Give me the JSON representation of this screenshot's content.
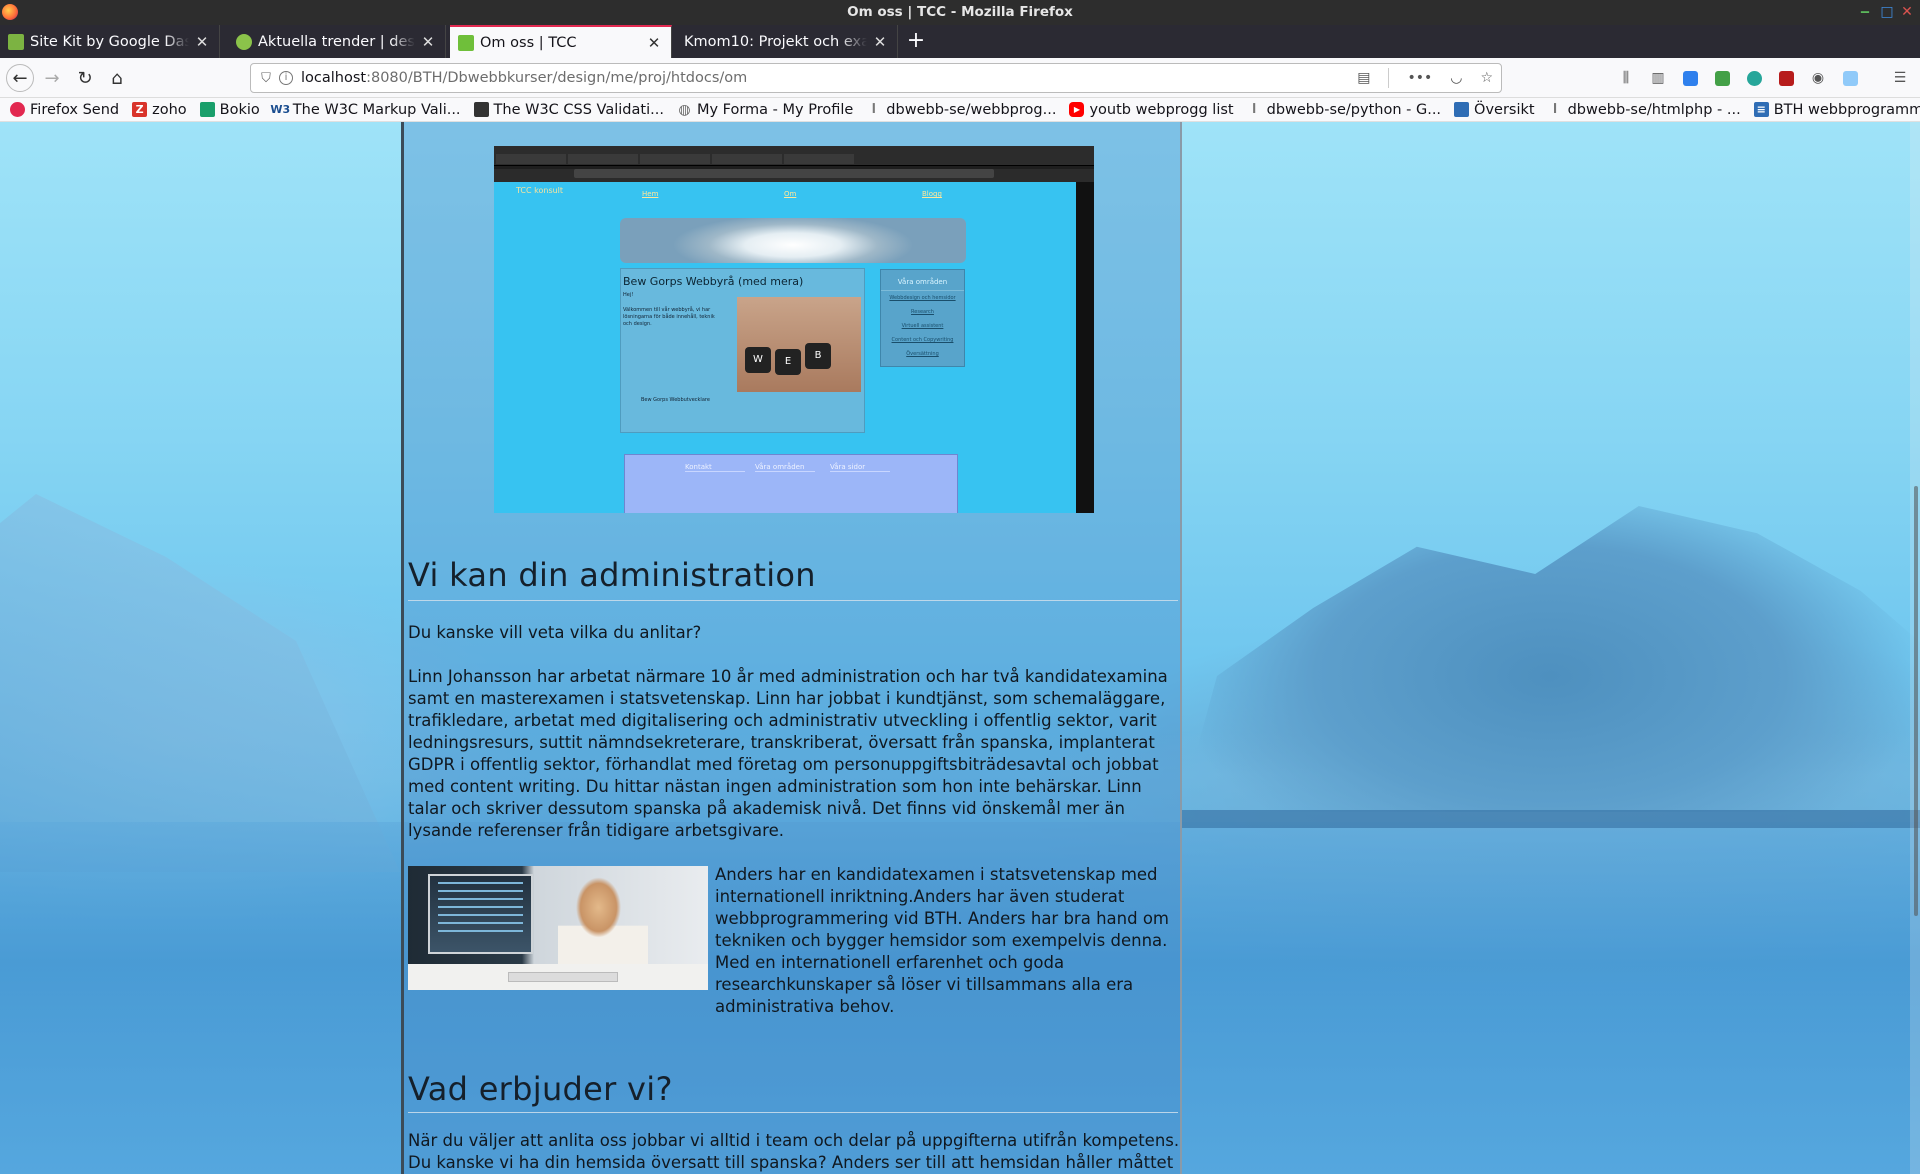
{
  "window": {
    "title": "Om oss | TCC - Mozilla Firefox"
  },
  "tabs": [
    {
      "label": "Site Kit by Google Dashboard",
      "active": false
    },
    {
      "label": "Aktuella trender | design",
      "active": false
    },
    {
      "label": "Om oss | TCC",
      "active": true
    },
    {
      "label": "Kmom10: Projekt och examination",
      "active": false
    }
  ],
  "url": {
    "host": "localhost",
    "path": ":8080/BTH/Dbwebbkurser/design/me/proj/htdocs/om"
  },
  "bookmarks": [
    {
      "label": "Firefox Send",
      "icon": "firefox-send-icon",
      "color": "#e22850"
    },
    {
      "label": "zoho",
      "icon": "zoho-icon",
      "color": "#d9342b"
    },
    {
      "label": "Bokio",
      "icon": "bokio-icon",
      "color": "#1a9f6b"
    },
    {
      "label": "The W3C Markup Vali...",
      "icon": "w3c-icon",
      "color": "#1a4d8f"
    },
    {
      "label": "The W3C CSS Validati...",
      "icon": "css-validator-icon",
      "color": "#333333"
    },
    {
      "label": "My Forma - My Profile",
      "icon": "globe-icon",
      "color": "#666666"
    },
    {
      "label": "dbwebb-se/webbprog...",
      "icon": "dbwebb-icon",
      "color": "#777777"
    },
    {
      "label": "youtb webprogg list",
      "icon": "youtube-icon",
      "color": "#ff0000"
    },
    {
      "label": "dbwebb-se/python - G...",
      "icon": "dbwebb-icon",
      "color": "#777777"
    },
    {
      "label": "Översikt",
      "icon": "overview-icon",
      "color": "#2f6db5"
    },
    {
      "label": "dbwebb-se/htmlphp - ...",
      "icon": "dbwebb-icon",
      "color": "#777777"
    },
    {
      "label": "BTH webbprogramme...",
      "icon": "document-icon",
      "color": "#2f6db5"
    }
  ],
  "embedded_screenshot": {
    "logo": "TCC konsult",
    "nav": [
      "Hem",
      "Om",
      "Blogg"
    ],
    "main_heading": "Bew Gorps Webbyrå (med mera)",
    "main_greeting": "Hej!",
    "main_text": "Välkommen till vår webbyrå, vi har lösningarna för både innehåll, teknik och design.",
    "keys": [
      "W",
      "E",
      "B"
    ],
    "author": "Bew Gorps Webbutvecklare",
    "sidebar_heading": "Våra områden",
    "sidebar_links": [
      "Webbdesign och hemsidor",
      "Research",
      "Virtuell assistent",
      "Content och Copywriting",
      "Översättning"
    ],
    "footer_headings": [
      "Kontakt",
      "Våra områden",
      "Våra sidor"
    ]
  },
  "section1": {
    "heading": "Vi kan din administration",
    "lead": "Du kanske vill veta vilka du anlitar?",
    "paragraph": "Linn Johansson har arbetat närmare 10 år med administration och har två kandidatexamina samt en masterexamen i statsvetenskap. Linn har jobbat i kundtjänst, som schemaläggare, trafikledare, arbetat med digitalisering och administrativ utveckling i offentlig sektor, varit ledningsresurs, suttit nämndsekreterare, transkriberat, översatt från spanska, implanterat GDPR i offentlig sektor, förhandlat med företag om personuppgiftsbiträdesavtal och jobbat med content writing. Du hittar nästan ingen administration som hon inte behärskar. Linn talar och skriver dessutom spanska på akademisk nivå. Det finns vid önskemål mer än lysande referenser från tidigare arbetsgivare.",
    "anders": "Anders har en kandidatexamen i statsvetenskap med internationell inriktning.Anders har även studerat webbprogrammering vid BTH. Anders har bra hand om tekniken och bygger hemsidor som exempelvis denna. Med en internationell erfarenhet och goda researchkunskaper så löser vi tillsammans alla era administrativa behov."
  },
  "section2": {
    "heading": "Vad erbjuder vi?",
    "line1": "När du väljer att anlita oss jobbar vi alltid i team och delar på uppgifterna utifrån kompetens.",
    "line2": "Du kanske vi ha din hemsida översatt till spanska? Anders ser till att hemsidan håller måttet och"
  }
}
